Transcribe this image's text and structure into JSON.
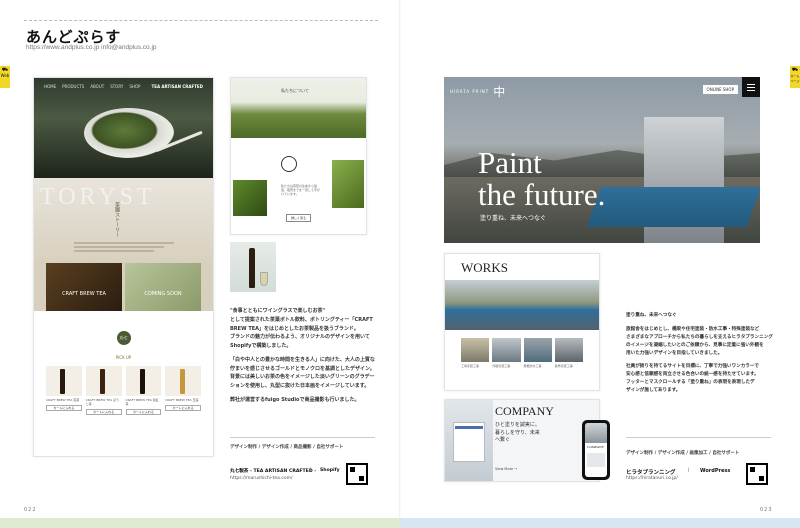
{
  "left": {
    "title": "あんどぷらす",
    "urls": "https://www.andplus.co.jp   info@andplus.co.jp",
    "tab": "Web",
    "site": {
      "brand": "TEA ARTISAN CRAFTED",
      "nav": [
        "HOME",
        "PRODUCTS",
        "ABOUT",
        "STORY",
        "SHOP",
        "CONTACT"
      ],
      "hero_watermark": "TORYST",
      "story_vertical": "茶園ストーリー",
      "craft_label": "CRAFT BREW TEA",
      "coming_label": "COMING SOON",
      "pickup_label": "PICK UP",
      "kanji_badge": "丸七",
      "products": [
        {
          "name": "CRAFT BREW TEA 煎茶",
          "button": "カートに入れる"
        },
        {
          "name": "CRAFT BREW TEA ほうじ茶",
          "button": "カートに入れる"
        },
        {
          "name": "CRAFT BREW TEA 和紅茶",
          "button": "カートに入れる"
        },
        {
          "name": "CRAFT BREW TEA 玉露",
          "button": "カートに入れる"
        }
      ]
    },
    "mid_site": {
      "banner": "私たちについて",
      "body": "私たちは茶葉の生産から製造、販売までを一貫して手がけています。",
      "btn": "詳しく見る"
    },
    "blurb": [
      "\"食事とともにワイングラスで楽しむお茶\"",
      "として提案された茶葉ボトル飲料、ボトリングティー「CRAFT",
      "BREW TEA」をはじめとしたお茶製品を扱うブランド。",
      "ブランドの魅力が伝わるよう、オリジナルのデザインを用いて",
      "Shopifyで構築しました。",
      "",
      "「白や中人との豊かな時間を生きる人」に向けた、大人の上質な",
      "佇まいを感じさせるゴールドとモノクロを基調としたデザイン。",
      "背景には美しいお茶の色をイメージした淡いグリーンのグラデー",
      "ションを使用し、丸型に抜けた日本画をイメージしています。",
      "",
      "弊社が運営するfuigo Studioで商品撮影も行いました。"
    ],
    "credits": "デザイン制作 / デザイン作成 / 商品撮影 / 自社サポート",
    "footer_name": "丸七製茶 - TEA ARTISAN CRAFTED -",
    "footer_sep": "|",
    "footer_platform": "Shopify",
    "footer_url": "https://marushichi-tea.com/",
    "page_number": "022"
  },
  "right": {
    "tab": "ホームページ",
    "site": {
      "logo_text": "HIRATA PRINT",
      "shop_btn": "ONLINE SHOP",
      "hero_line1": "Paint",
      "hero_line2": "the future.",
      "hero_sub": "塗り重ね、未来へつなぐ",
      "works_title": "WORKS",
      "works_captions": [
        "工場塗装工事",
        "外壁塗装工事",
        "屋根防水工事",
        "鉄骨塗装工事"
      ],
      "company_title": "COMPANY",
      "company_copy": "ひと塗りを誠実に。暮らしを守り、未来へ繋ぐ",
      "company_more": "View More →",
      "phone_label": "COMPANY"
    },
    "blurb_title": "塗り重ね、未来へつなぐ",
    "blurb": [
      "旅館舎をはじめとし、橋梁や住宅塗装・防水工事・特殊塗装など",
      "さまざまなアプローチから私たちの暮らしを支えるヒラタプランニング",
      "のイメージを凝縮したいとのご依頼から、見事に定着に強い外観を",
      "用いた力強いデザインを目指していきました。",
      "",
      "社員が誇りを持てるサイトを目標に、丁寧で力強いワンカラーで",
      "安心感と信頼感を両立させる色合いの統一感を持たせています。",
      "フッターとマスクロールする「塗り重ね」の表現を表現したデ",
      "ザインが施してあります。"
    ],
    "credits": "デザイン制作 / デザイン作成 / 画像加工 / 自社サポート",
    "footer_name": "ヒラタプランニング",
    "footer_sep": "|",
    "footer_platform": "WordPress",
    "footer_url": "https://hiratanuri.co.jp/",
    "page_number": "023"
  },
  "colors": {
    "accent_yellow": "#f2d72a",
    "bottom_left": "#dfead2",
    "bottom_right": "#d7e6f0"
  }
}
